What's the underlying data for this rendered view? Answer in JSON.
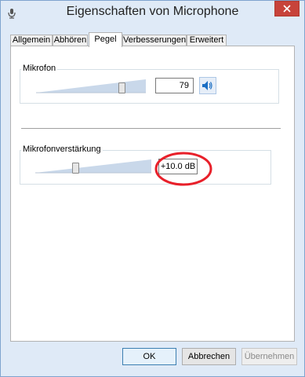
{
  "window": {
    "title": "Eigenschaften von Microphone",
    "close_icon": "close-icon",
    "title_icon": "microphone-icon"
  },
  "tabs": [
    {
      "label": "Allgemein",
      "active": false
    },
    {
      "label": "Abhören",
      "active": false
    },
    {
      "label": "Pegel",
      "active": true
    },
    {
      "label": "Verbesserungen",
      "active": false
    },
    {
      "label": "Erweitert",
      "active": false
    }
  ],
  "microphone": {
    "label": "Mikrofon",
    "value": "79",
    "level_fraction": 0.79,
    "speaker_icon": "speaker-icon"
  },
  "boost": {
    "label": "Mikrofonverstärkung",
    "value": "+10.0 dB",
    "level_fraction": 0.33
  },
  "annotation": {
    "shape": "red-ellipse",
    "color": "#e8202a"
  },
  "buttons": {
    "ok": "OK",
    "cancel": "Abbrechen",
    "apply": "Übernehmen"
  },
  "colors": {
    "close_button": "#c7433a",
    "window_frame": "#dfeaf7",
    "speaker_blue": "#1c6fc4"
  }
}
